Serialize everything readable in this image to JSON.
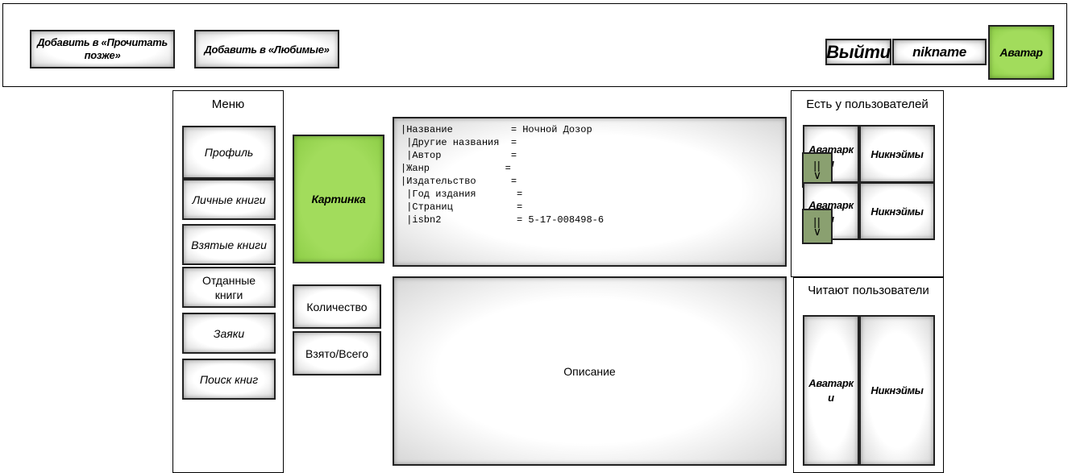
{
  "header": {
    "read_later_label": "Добавить в «Прочитать позже»",
    "favorites_label": "Добавить в «Любимые»",
    "logout_label": "Выйти",
    "nickname_label": "nikname",
    "avatar_label": "Аватар",
    "colors": {
      "accent_green": "#9edc5a"
    }
  },
  "menu": {
    "title": "Меню",
    "items": [
      {
        "label": "Профиль"
      },
      {
        "label": "Личные книги"
      },
      {
        "label": "Взятые книги"
      },
      {
        "label": "Отданные книги"
      },
      {
        "label": "Заяки"
      },
      {
        "label": "Поиск книг"
      }
    ]
  },
  "book": {
    "picture_label": "Картинка",
    "count_label": "Количество",
    "taken_total_label": "Взято/Всего",
    "info_lines": [
      "|Название          = Ночной Дозор",
      " |Другие названия  =",
      " |Автор            =",
      "|Жанр             =",
      "|Издательство      =",
      " |Год издания       =",
      " |Страниц           =",
      " |isbn2             = 5-17-008498-6"
    ],
    "description_label": "Описание"
  },
  "owners_panel": {
    "title": "Есть у пользователей",
    "rows": [
      {
        "avatar_label": "Аватарки",
        "nick_label": "Никнэймы",
        "arrow_icon": "up-down-arrows-icon"
      },
      {
        "avatar_label": "Аватарки",
        "nick_label": "Никнэймы",
        "arrow_icon": "up-down-arrows-icon"
      }
    ]
  },
  "readers_panel": {
    "title": "Читают пользователи",
    "avatar_label": "Аватарки",
    "nick_label": "Никнэймы"
  }
}
